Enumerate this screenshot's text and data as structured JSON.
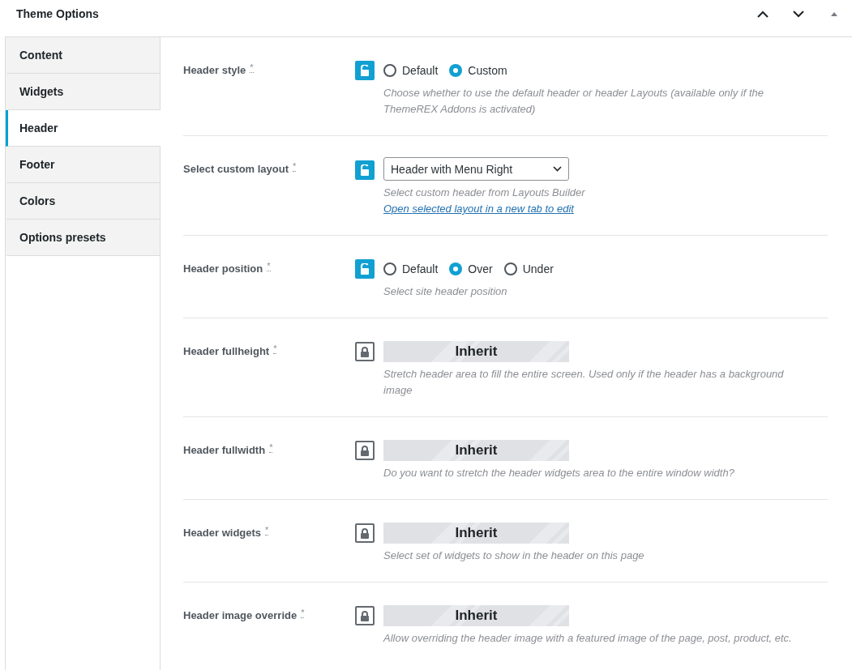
{
  "panel": {
    "title": "Theme Options"
  },
  "tabs": [
    {
      "label": "Content",
      "selected": false
    },
    {
      "label": "Widgets",
      "selected": false
    },
    {
      "label": "Header",
      "selected": true
    },
    {
      "label": "Footer",
      "selected": false
    },
    {
      "label": "Colors",
      "selected": false
    },
    {
      "label": "Options presets",
      "selected": false
    }
  ],
  "options": [
    {
      "label": "Header style",
      "mark": "*",
      "locked": false,
      "kind": "radio",
      "choices": [
        {
          "label": "Default",
          "selected": false
        },
        {
          "label": "Custom",
          "selected": true
        }
      ],
      "description": "Choose whether to use the default header or header Layouts (available only if the ThemeREX Addons is activated)"
    },
    {
      "label": "Select custom layout",
      "mark": "*",
      "locked": false,
      "kind": "select",
      "value": "Header with Menu Right",
      "description": "Select custom header from Layouts Builder",
      "link": "Open selected layout in a new tab to edit"
    },
    {
      "label": "Header position",
      "mark": "*",
      "locked": false,
      "kind": "radio",
      "choices": [
        {
          "label": "Default",
          "selected": false
        },
        {
          "label": "Over",
          "selected": true
        },
        {
          "label": "Under",
          "selected": false
        }
      ],
      "description": "Select site header position"
    },
    {
      "label": "Header fullheight",
      "mark": "*",
      "locked": true,
      "kind": "inherit",
      "value": "Inherit",
      "description": "Stretch header area to fill the entire screen. Used only if the header has a background image"
    },
    {
      "label": "Header fullwidth",
      "mark": "*",
      "locked": true,
      "kind": "inherit",
      "value": "Inherit",
      "description": "Do you want to stretch the header widgets area to the entire window width?"
    },
    {
      "label": "Header widgets",
      "mark": "*",
      "locked": true,
      "kind": "inherit",
      "value": "Inherit",
      "description": "Select set of widgets to show in the header on this page"
    },
    {
      "label": "Header image override",
      "mark": "*",
      "locked": true,
      "kind": "inherit",
      "value": "Inherit",
      "description": "Allow overriding the header image with a featured image of the page, post, product, etc."
    }
  ]
}
